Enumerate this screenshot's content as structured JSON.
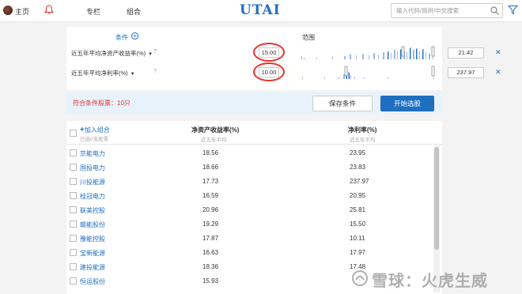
{
  "nav": {
    "home_label": "主页",
    "column_label": "专栏",
    "portfolio_label": "组合",
    "logo_text": "UTAI",
    "search_placeholder": "输入代码/简拼/中文搜索"
  },
  "conditions": {
    "title": "条件",
    "range_title": "范围",
    "rows": [
      {
        "label": "近五年平均净资产收益率(%)",
        "min": "15.00",
        "max": "21.42"
      },
      {
        "label": "近五年平均净利率(%)",
        "min": "10.00",
        "max": "237.97"
      }
    ]
  },
  "results": {
    "label": "符合条件股票：10只",
    "save_label": "保存条件",
    "start_label": "开始选股"
  },
  "table": {
    "add_group": "加入组合",
    "add_sub": "已选0支股票",
    "col1": "净资产收益率(%)",
    "col1_sub": "近五年平均",
    "col2": "净利率(%)",
    "col2_sub": "近五年平均",
    "rows": [
      {
        "name": "京能电力",
        "roe": "18.56",
        "margin": "23.95"
      },
      {
        "name": "国投电力",
        "roe": "18.66",
        "margin": "23.83"
      },
      {
        "name": "川投能源",
        "roe": "17.73",
        "margin": "237.97"
      },
      {
        "name": "桂冠电力",
        "roe": "16.59",
        "margin": "20.95"
      },
      {
        "name": "联美控股",
        "roe": "20.96",
        "margin": "25.81"
      },
      {
        "name": "赣能股份",
        "roe": "19.29",
        "margin": "15.50"
      },
      {
        "name": "豫能控股",
        "roe": "17.87",
        "margin": "10.11"
      },
      {
        "name": "宝新能源",
        "roe": "16.63",
        "margin": "17.97"
      },
      {
        "name": "建投能源",
        "roe": "18.36",
        "margin": "17.48"
      },
      {
        "name": "恒运股份",
        "roe": "15.93",
        "margin": ""
      }
    ]
  },
  "watermark": "雪球：火虎生威",
  "colors": {
    "accent": "#1e6fc0",
    "highlight": "#e5322d",
    "result_bg": "#e8f2fb"
  }
}
